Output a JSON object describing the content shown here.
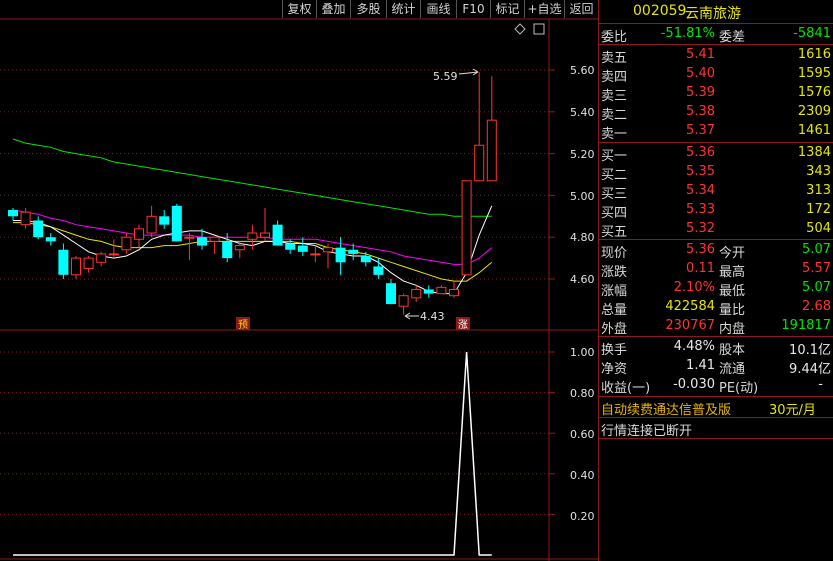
{
  "toolbar": {
    "buttons": [
      "复权",
      "叠加",
      "多股",
      "统计",
      "画线",
      "F10",
      "标记",
      "+自选",
      "返回"
    ]
  },
  "stock": {
    "code": "002059",
    "name": "云南旅游"
  },
  "colors": {
    "up": "#ff3232",
    "down": "#00ffff",
    "ma5": "#ffffff",
    "ma10": "#e6e600",
    "ma20": "#ff00ff",
    "ma60": "#00e600",
    "grid": "#8b1a1a"
  },
  "main_axis": {
    "labels": [
      "5.60",
      "5.40",
      "5.20",
      "5.00",
      "4.80",
      "4.60"
    ]
  },
  "sub_axis": {
    "labels": [
      "1.00",
      "0.80",
      "0.60",
      "0.40",
      "0.20"
    ]
  },
  "annotations": {
    "high": "5.59",
    "low": "4.43",
    "marker_pre": "预",
    "marker_up": "涨"
  },
  "quote": {
    "ratio_label": "委比",
    "ratio_value": "-51.81%",
    "diff_label": "委差",
    "diff_value": "-5841",
    "asks": [
      {
        "label": "卖五",
        "price": "5.41",
        "vol": "1616"
      },
      {
        "label": "卖四",
        "price": "5.40",
        "vol": "1595"
      },
      {
        "label": "卖三",
        "price": "5.39",
        "vol": "1576"
      },
      {
        "label": "卖二",
        "price": "5.38",
        "vol": "2309"
      },
      {
        "label": "卖一",
        "price": "5.37",
        "vol": "1461"
      }
    ],
    "bids": [
      {
        "label": "买一",
        "price": "5.36",
        "vol": "1384"
      },
      {
        "label": "买二",
        "price": "5.35",
        "vol": "343"
      },
      {
        "label": "买三",
        "price": "5.34",
        "vol": "313"
      },
      {
        "label": "买四",
        "price": "5.33",
        "vol": "172"
      },
      {
        "label": "买五",
        "price": "5.32",
        "vol": "504"
      }
    ],
    "stats": [
      {
        "l1": "现价",
        "v1": "5.36",
        "c1": "red",
        "l2": "今开",
        "v2": "5.07",
        "c2": "green"
      },
      {
        "l1": "涨跌",
        "v1": "0.11",
        "c1": "red",
        "l2": "最高",
        "v2": "5.57",
        "c2": "red"
      },
      {
        "l1": "涨幅",
        "v1": "2.10%",
        "c1": "red",
        "l2": "最低",
        "v2": "5.07",
        "c2": "green"
      },
      {
        "l1": "总量",
        "v1": "422584",
        "c1": "yellow",
        "l2": "量比",
        "v2": "2.68",
        "c2": "red"
      },
      {
        "l1": "外盘",
        "v1": "230767",
        "c1": "red",
        "l2": "内盘",
        "v2": "191817",
        "c2": "green"
      }
    ],
    "fin": [
      {
        "l1": "换手",
        "v1": "4.48%",
        "l2": "股本",
        "v2": "10.1亿"
      },
      {
        "l1": "净资",
        "v1": "1.41",
        "l2": "流通",
        "v2": "9.44亿"
      },
      {
        "l1": "收益(一)",
        "v1": "-0.030",
        "l2": "PE(动)",
        "v2": "-"
      }
    ],
    "promo_text": "自动续费通达信普及版",
    "promo_price": "30元/月",
    "status": "行情连接已断开"
  },
  "chart_data": {
    "type": "candlestick",
    "price_ylim": [
      4.35,
      5.72
    ],
    "candles": [
      {
        "o": 4.93,
        "h": 4.94,
        "l": 4.88,
        "c": 4.9
      },
      {
        "o": 4.86,
        "h": 4.94,
        "l": 4.84,
        "c": 4.92
      },
      {
        "o": 4.88,
        "h": 4.9,
        "l": 4.79,
        "c": 4.8
      },
      {
        "o": 4.8,
        "h": 4.82,
        "l": 4.76,
        "c": 4.78
      },
      {
        "o": 4.74,
        "h": 4.77,
        "l": 4.6,
        "c": 4.62
      },
      {
        "o": 4.62,
        "h": 4.71,
        "l": 4.6,
        "c": 4.7
      },
      {
        "o": 4.65,
        "h": 4.71,
        "l": 4.63,
        "c": 4.7
      },
      {
        "o": 4.68,
        "h": 4.73,
        "l": 4.66,
        "c": 4.72
      },
      {
        "o": 4.72,
        "h": 4.79,
        "l": 4.7,
        "c": 4.72
      },
      {
        "o": 4.74,
        "h": 4.82,
        "l": 4.72,
        "c": 4.8
      },
      {
        "o": 4.79,
        "h": 4.86,
        "l": 4.75,
        "c": 4.84
      },
      {
        "o": 4.82,
        "h": 4.95,
        "l": 4.8,
        "c": 4.9
      },
      {
        "o": 4.9,
        "h": 4.93,
        "l": 4.84,
        "c": 4.86
      },
      {
        "o": 4.95,
        "h": 4.96,
        "l": 4.78,
        "c": 4.78
      },
      {
        "o": 4.8,
        "h": 4.82,
        "l": 4.69,
        "c": 4.8
      },
      {
        "o": 4.8,
        "h": 4.84,
        "l": 4.74,
        "c": 4.76
      },
      {
        "o": 4.78,
        "h": 4.8,
        "l": 4.72,
        "c": 4.8
      },
      {
        "o": 4.78,
        "h": 4.82,
        "l": 4.68,
        "c": 4.7
      },
      {
        "o": 4.74,
        "h": 4.78,
        "l": 4.7,
        "c": 4.76
      },
      {
        "o": 4.79,
        "h": 4.86,
        "l": 4.74,
        "c": 4.82
      },
      {
        "o": 4.8,
        "h": 4.94,
        "l": 4.78,
        "c": 4.82
      },
      {
        "o": 4.86,
        "h": 4.88,
        "l": 4.77,
        "c": 4.76
      },
      {
        "o": 4.77,
        "h": 4.79,
        "l": 4.72,
        "c": 4.74
      },
      {
        "o": 4.76,
        "h": 4.8,
        "l": 4.71,
        "c": 4.73
      },
      {
        "o": 4.72,
        "h": 4.76,
        "l": 4.68,
        "c": 4.72
      },
      {
        "o": 4.73,
        "h": 4.77,
        "l": 4.65,
        "c": 4.75
      },
      {
        "o": 4.75,
        "h": 4.8,
        "l": 4.62,
        "c": 4.68
      },
      {
        "o": 4.74,
        "h": 4.77,
        "l": 4.69,
        "c": 4.72
      },
      {
        "o": 4.71,
        "h": 4.73,
        "l": 4.66,
        "c": 4.68
      },
      {
        "o": 4.66,
        "h": 4.7,
        "l": 4.6,
        "c": 4.62
      },
      {
        "o": 4.58,
        "h": 4.6,
        "l": 4.48,
        "c": 4.48
      },
      {
        "o": 4.47,
        "h": 4.53,
        "l": 4.43,
        "c": 4.52
      },
      {
        "o": 4.51,
        "h": 4.57,
        "l": 4.49,
        "c": 4.55
      },
      {
        "o": 4.55,
        "h": 4.57,
        "l": 4.51,
        "c": 4.53
      },
      {
        "o": 4.53,
        "h": 4.57,
        "l": 4.53,
        "c": 4.56
      },
      {
        "o": 4.52,
        "h": 4.59,
        "l": 4.51,
        "c": 4.55
      },
      {
        "o": 4.62,
        "h": 5.07,
        "l": 4.62,
        "c": 5.07
      },
      {
        "o": 5.07,
        "h": 5.59,
        "l": 5.07,
        "c": 5.24
      },
      {
        "o": 5.07,
        "h": 5.57,
        "l": 5.07,
        "c": 5.36
      }
    ],
    "ma5": [
      4.88,
      4.88,
      4.87,
      4.85,
      4.81,
      4.77,
      4.73,
      4.71,
      4.7,
      4.71,
      4.74,
      4.79,
      4.81,
      4.82,
      4.83,
      4.83,
      4.81,
      4.79,
      4.77,
      4.76,
      4.78,
      4.78,
      4.77,
      4.77,
      4.76,
      4.73,
      4.72,
      4.71,
      4.71,
      4.68,
      4.63,
      4.59,
      4.57,
      4.54,
      4.53,
      4.53,
      4.63,
      4.81,
      4.95
    ],
    "ma10": [
      4.87,
      4.87,
      4.86,
      4.85,
      4.83,
      4.81,
      4.79,
      4.78,
      4.76,
      4.75,
      4.75,
      4.75,
      4.76,
      4.76,
      4.77,
      4.78,
      4.78,
      4.78,
      4.78,
      4.78,
      4.78,
      4.78,
      4.78,
      4.77,
      4.77,
      4.75,
      4.74,
      4.73,
      4.72,
      4.7,
      4.68,
      4.66,
      4.64,
      4.62,
      4.6,
      4.59,
      4.59,
      4.63,
      4.68
    ],
    "ma20": [
      4.93,
      4.92,
      4.91,
      4.89,
      4.88,
      4.86,
      4.85,
      4.84,
      4.83,
      4.82,
      4.81,
      4.81,
      4.81,
      4.81,
      4.81,
      4.8,
      4.8,
      4.8,
      4.8,
      4.8,
      4.8,
      4.79,
      4.79,
      4.79,
      4.79,
      4.78,
      4.77,
      4.76,
      4.75,
      4.74,
      4.73,
      4.71,
      4.7,
      4.69,
      4.68,
      4.67,
      4.67,
      4.7,
      4.75
    ],
    "ma60": [
      5.27,
      5.25,
      5.24,
      5.23,
      5.21,
      5.2,
      5.19,
      5.18,
      5.16,
      5.15,
      5.14,
      5.13,
      5.12,
      5.11,
      5.1,
      5.09,
      5.08,
      5.07,
      5.06,
      5.05,
      5.04,
      5.03,
      5.02,
      5.01,
      5.0,
      4.99,
      4.98,
      4.97,
      4.96,
      4.95,
      4.94,
      4.93,
      4.92,
      4.91,
      4.91,
      4.9,
      4.9,
      4.9,
      4.9
    ],
    "indicator": {
      "ylim": [
        0,
        1.1
      ],
      "values": [
        0,
        0,
        0,
        0,
        0,
        0,
        0,
        0,
        0,
        0,
        0,
        0,
        0,
        0,
        0,
        0,
        0,
        0,
        0,
        0,
        0,
        0,
        0,
        0,
        0,
        0,
        0,
        0,
        0,
        0,
        0,
        0,
        0,
        0,
        0,
        0,
        1,
        0,
        0
      ]
    }
  }
}
